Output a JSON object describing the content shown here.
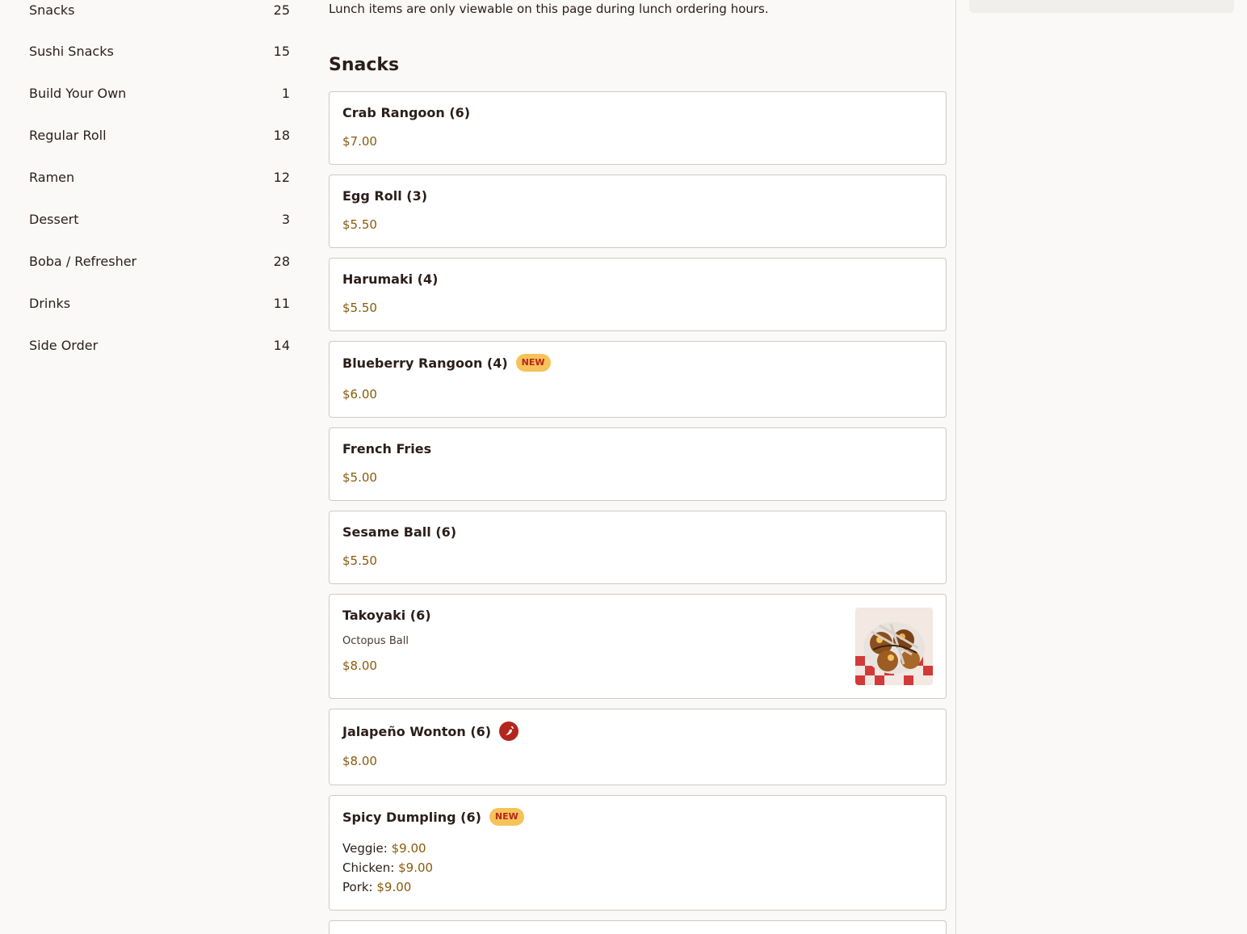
{
  "sidebar": {
    "categories": [
      {
        "label": "Snacks",
        "count": "25"
      },
      {
        "label": "Sushi Snacks",
        "count": "15"
      },
      {
        "label": "Build Your Own",
        "count": "1"
      },
      {
        "label": "Regular Roll",
        "count": "18"
      },
      {
        "label": "Ramen",
        "count": "12"
      },
      {
        "label": "Dessert",
        "count": "3"
      },
      {
        "label": "Boba / Refresher",
        "count": "28"
      },
      {
        "label": "Drinks",
        "count": "11"
      },
      {
        "label": "Side Order",
        "count": "14"
      }
    ]
  },
  "main": {
    "notice": "Lunch items are only viewable on this page during lunch ordering hours.",
    "section_title": "Snacks",
    "badge_new": "NEW",
    "items": [
      {
        "name": "Crab Rangoon (6)",
        "price": "$7.00"
      },
      {
        "name": "Egg Roll (3)",
        "price": "$5.50"
      },
      {
        "name": "Harumaki (4)",
        "price": "$5.50"
      },
      {
        "name": "Blueberry Rangoon (4)",
        "price": "$6.00"
      },
      {
        "name": "French Fries",
        "price": "$5.00"
      },
      {
        "name": "Sesame Ball (6)",
        "price": "$5.50"
      },
      {
        "name": "Takoyaki (6)",
        "description": "Octopus Ball",
        "price": "$8.00"
      },
      {
        "name": "Jalapeño Wonton (6)",
        "price": "$8.00"
      },
      {
        "name": "Spicy Dumpling (6)",
        "options": [
          {
            "label": "Veggie:",
            "price": "$9.00"
          },
          {
            "label": "Chicken:",
            "price": "$9.00"
          },
          {
            "label": "Pork:",
            "price": "$9.00"
          }
        ]
      }
    ]
  },
  "colors": {
    "price": "#8a5a0c",
    "badge_bg": "#f6c35a",
    "badge_text": "#b3261e",
    "spicy_icon": "#b3261e"
  }
}
